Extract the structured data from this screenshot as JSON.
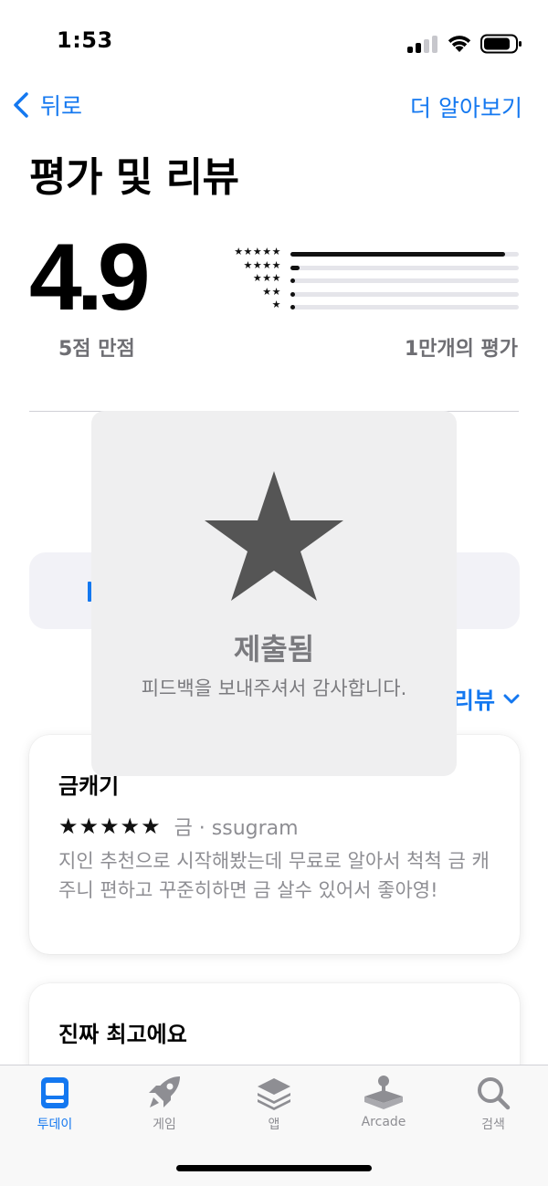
{
  "status_bar": {
    "time": "1:53"
  },
  "nav": {
    "back_label": "뒤로",
    "more_label": "더 알아보기"
  },
  "page_title": "평가 및 리뷰",
  "summary": {
    "score": "4.9",
    "out_of": "5점 만점",
    "count": "1만개의 평가",
    "histogram": [
      {
        "stars": "★★★★★",
        "fraction": 0.94
      },
      {
        "stars": "★★★★",
        "fraction": 0.04
      },
      {
        "stars": "★★★",
        "fraction": 0.01
      },
      {
        "stars": "★★",
        "fraction": 0.01
      },
      {
        "stars": "★",
        "fraction": 0.01
      }
    ]
  },
  "sort": {
    "label": "리뷰"
  },
  "reviews": [
    {
      "title": "금캐기",
      "stars": "★★★★★",
      "author": "금 · ssugram",
      "body": "지인 추천으로 시작해봤는데 무료로 알아서 척척 금 캐주니 편하고 꾸준히하면 금 살수 있어서 좋아영!"
    },
    {
      "title": "진짜 최고에요"
    }
  ],
  "overlay": {
    "icon": "star-icon",
    "title": "제출됨",
    "message": "피드백을 보내주셔서 감사합니다."
  },
  "tab_bar": {
    "items": [
      {
        "label": "투데이",
        "icon": "today-icon",
        "active": true
      },
      {
        "label": "게임",
        "icon": "rocket-icon",
        "active": false
      },
      {
        "label": "앱",
        "icon": "layers-icon",
        "active": false
      },
      {
        "label": "Arcade",
        "icon": "joystick-icon",
        "active": false
      },
      {
        "label": "검색",
        "icon": "search-icon",
        "active": false
      }
    ]
  },
  "colors": {
    "accent": "#1478f0",
    "secondary_text": "#8e8e93"
  }
}
